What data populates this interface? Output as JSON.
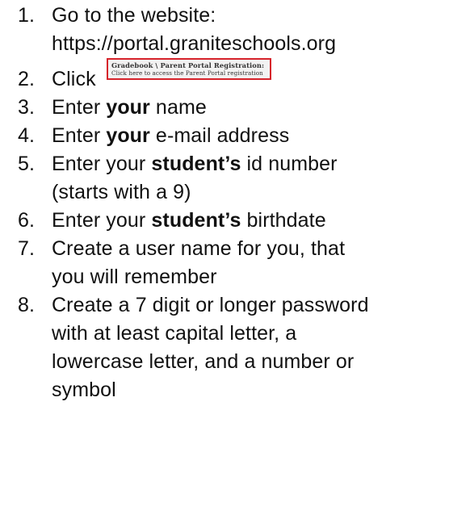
{
  "steps": [
    {
      "number": "1.",
      "lines": [
        "Go to the website:",
        "https://portal.graniteschools.org"
      ]
    },
    {
      "number": "2.",
      "text": "Click",
      "button_image": {
        "title": "Gradebook \\ Parent Portal Registration:",
        "subtitle": "Click here to access the Parent Portal registration",
        "border_color": "#d6232b"
      }
    },
    {
      "number": "3.",
      "pre": "Enter ",
      "bold": "your",
      "post": " name"
    },
    {
      "number": "4.",
      "pre": "Enter ",
      "bold": "your",
      "post": " e-mail address"
    },
    {
      "number": "5.",
      "pre": "Enter your ",
      "bold": "student’s",
      "post": " id number",
      "line2": "(starts with a 9)"
    },
    {
      "number": "6.",
      "pre": "Enter your ",
      "bold": "student’s",
      "post": " birthdate"
    },
    {
      "number": "7.",
      "lines": [
        "Create a user name for you, that",
        "you will remember"
      ]
    },
    {
      "number": "8.",
      "lines": [
        "Create a 7 digit or longer password",
        "with at least capital letter, a",
        "lowercase letter, and a number or",
        "symbol"
      ]
    }
  ]
}
